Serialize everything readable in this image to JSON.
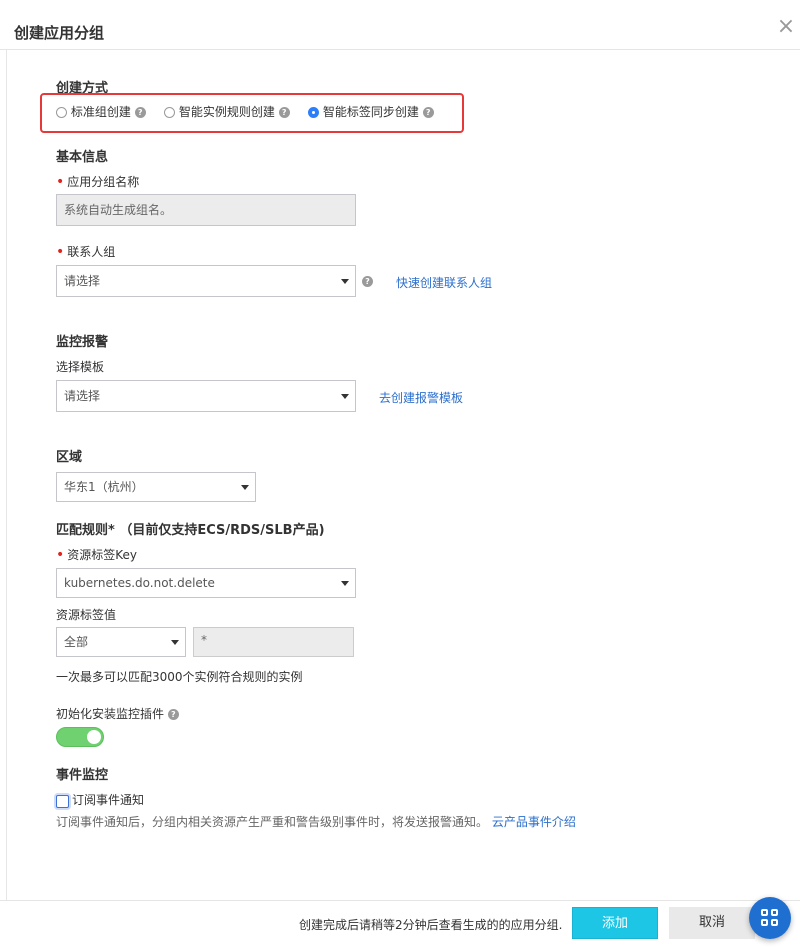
{
  "dialog": {
    "title": "创建应用分组"
  },
  "create_method": {
    "heading": "创建方式",
    "options": [
      {
        "label": "标准组创建",
        "selected": false
      },
      {
        "label": "智能实例规则创建",
        "selected": false
      },
      {
        "label": "智能标签同步创建",
        "selected": true
      }
    ]
  },
  "basic_info": {
    "heading": "基本信息",
    "group_name_label": "应用分组名称",
    "group_name_placeholder": "系统自动生成组名。",
    "contact_label": "联系人组",
    "contact_value": "请选择",
    "quick_create_link": "快速创建联系人组"
  },
  "alarm": {
    "heading": "监控报警",
    "template_label": "选择模板",
    "template_value": "请选择",
    "create_template_link": "去创建报警模板"
  },
  "region": {
    "heading": "区域",
    "value": "华东1（杭州）"
  },
  "match_rules": {
    "heading": "匹配规则* （目前仅支持ECS/RDS/SLB产品)",
    "tag_key_label": "资源标签Key",
    "tag_key_value": "kubernetes.do.not.delete",
    "tag_value_label": "资源标签值",
    "tag_value_mode": "全部",
    "tag_value_input": "*",
    "limit_note": "一次最多可以匹配3000个实例符合规则的实例"
  },
  "plugin": {
    "label": "初始化安装监控插件",
    "enabled": true
  },
  "event": {
    "heading": "事件监控",
    "subscribe_label": "订阅事件通知",
    "subscribe_checked": false,
    "description": "订阅事件通知后，分组内相关资源产生严重和警告级别事件时，将发送报警通知。",
    "intro_link": "云产品事件介绍"
  },
  "footer": {
    "note": "创建完成后请稍等2分钟后查看生成的的应用分组.",
    "add_label": "添加",
    "cancel_label": "取消"
  },
  "colors": {
    "primary_button": "#1ec6e6",
    "link": "#2b6fce",
    "required": "#e1251b",
    "switch_on": "#6fd16f",
    "highlight_box": "#e5393a"
  }
}
